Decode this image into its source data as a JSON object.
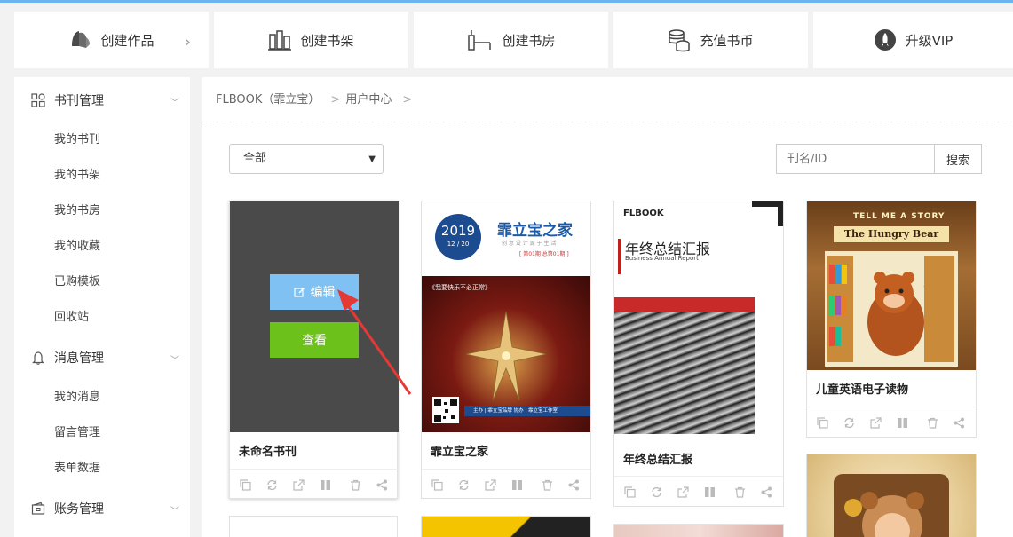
{
  "top_actions": [
    {
      "label": "创建作品",
      "icon": "book-pages-icon"
    },
    {
      "label": "创建书架",
      "icon": "bookshelf-icon"
    },
    {
      "label": "创建书房",
      "icon": "book-room-icon"
    },
    {
      "label": "充值书币",
      "icon": "coins-icon"
    },
    {
      "label": "升级VIP",
      "icon": "rocket-icon"
    }
  ],
  "sidebar": {
    "sections": [
      {
        "label": "书刊管理",
        "icon": "grid-icon",
        "items": [
          "我的书刊",
          "我的书架",
          "我的书房",
          "我的收藏",
          "已购模板",
          "回收站"
        ]
      },
      {
        "label": "消息管理",
        "icon": "bell-icon",
        "items": [
          "我的消息",
          "留言管理",
          "表单数据"
        ]
      },
      {
        "label": "账务管理",
        "icon": "wallet-icon",
        "items": []
      }
    ]
  },
  "breadcrumb": {
    "root": "FLBOOK（霏立宝）",
    "current": "用户中心"
  },
  "filter": {
    "selected": "全部"
  },
  "search": {
    "placeholder": "刊名/ID",
    "button": "搜索"
  },
  "cards": [
    {
      "title": "未命名书刊",
      "edit_label": "编辑",
      "view_label": "查看"
    },
    {
      "title": "霏立宝之家",
      "cover_year": "2019",
      "cover_date": "12 / 20",
      "cover_title": "霏立宝之家",
      "cover_sub": "创 意 设 计     源 于 生 活",
      "cover_issue": "[ 第01期 总第01期 ]",
      "cover_quote": "《我要快乐不必正常》",
      "cover_footer": "主办 | 霏立宝品牌 协办 | 霏立宝工作室"
    },
    {
      "title": "年终总结汇报",
      "cover_logo": "FLBOOK",
      "cover_heading": "年终总结汇报",
      "cover_en": "Business Annual Report"
    },
    {
      "title": "儿童英语电子读物",
      "cover_banner": "TELL ME A STORY",
      "cover_heading": "The Hungry Bear"
    }
  ],
  "colors": {
    "accent": "#7ec1f2",
    "view_button": "#6cc11a",
    "top_line": "#6cb4f0"
  }
}
